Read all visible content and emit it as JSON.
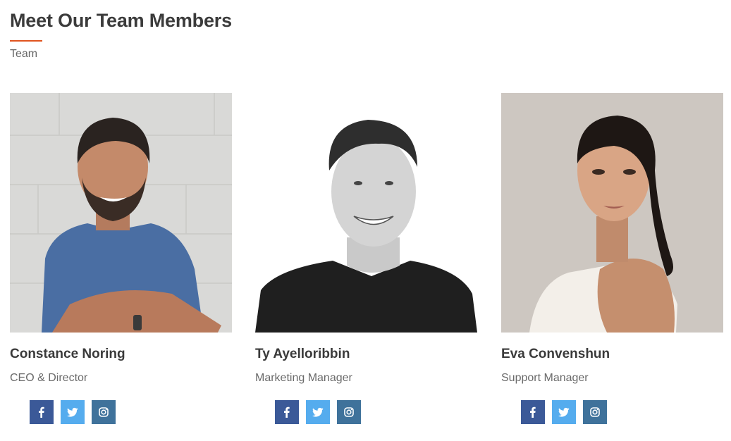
{
  "section": {
    "heading": "Meet Our Team Members",
    "subtitle": "Team",
    "accent_color": "#e0541f"
  },
  "members": [
    {
      "name": "Constance Noring",
      "role": "CEO & Director",
      "photo_icon": "person-photo-bearded-man-blue-shirt"
    },
    {
      "name": "Ty Ayelloribbin",
      "role": "Marketing Manager",
      "photo_icon": "person-photo-smiling-man-black-shirt"
    },
    {
      "name": "Eva Convenshun",
      "role": "Support Manager",
      "photo_icon": "person-photo-woman-white-top"
    }
  ],
  "social_icons": [
    {
      "name": "facebook-icon",
      "color": "#3b5998"
    },
    {
      "name": "twitter-icon",
      "color": "#55acee"
    },
    {
      "name": "instagram-icon",
      "color": "#3f729b"
    }
  ]
}
